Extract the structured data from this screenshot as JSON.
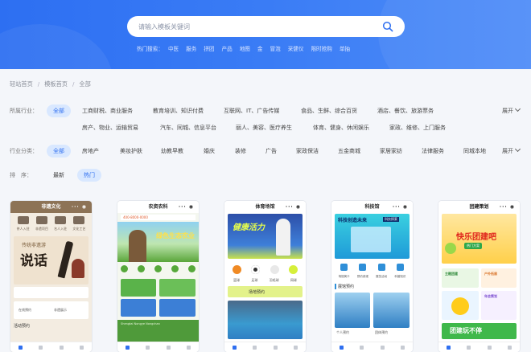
{
  "search": {
    "placeholder": "请输入模板关键词"
  },
  "hot": {
    "label": "热门搜索：",
    "items": [
      "中医",
      "服务",
      "拼团",
      "产品",
      "地图",
      "金",
      "冒泡",
      "采健仪",
      "限时抢购",
      "单抽"
    ]
  },
  "breadcrumb": [
    "轻站首页",
    "模板首页",
    "全部"
  ],
  "industry": {
    "label": "所属行业：",
    "row1": [
      "全部",
      "工商财税、商业服务",
      "教育培训、知识付费",
      "互联网、IT、广告传媒",
      "食品、生鲜、综合百货",
      "酒店、餐饮、旅游票务"
    ],
    "row2": [
      "房产、物业、运输贸易",
      "汽车、同城、信息平台",
      "丽人、美容、医疗养生",
      "体育、健身、休闲娱乐",
      "家政、维修、上门服务"
    ],
    "expand": "展开"
  },
  "category": {
    "label": "行业分类：",
    "items": [
      "全部",
      "房地产",
      "美妆护肤",
      "幼教早教",
      "婚庆",
      "装修",
      "广告",
      "家政保洁",
      "五金商城",
      "家居家纺",
      "法律服务",
      "同城本地"
    ],
    "expand": "展开"
  },
  "sort": {
    "label": "排　序：",
    "items": [
      "最新",
      "热门"
    ]
  },
  "colors": {
    "brand": "#2f6ff0",
    "active_bg": "#d9e8ff"
  },
  "templates": [
    {
      "title": "非遗文化",
      "icons": [
        "茶人入驻",
        "非遗项目",
        "名人入驻",
        "文化工艺"
      ],
      "headline": "说话",
      "line1": "传统非遗游",
      "bullets": [
        "在线预约",
        "非遗展示"
      ],
      "section": "活动预约",
      "nav": [
        "首页",
        "非遗活动",
        "非遗文化",
        "个人中心"
      ]
    },
    {
      "title": "农资农科",
      "phone": "400-8000-0000",
      "banner": "绿色生态农业",
      "icons": [
        "公司简介",
        "产品中心",
        "联系方式",
        "招商加盟",
        "合作伙伴"
      ],
      "section": "Shengtai Nongye Nongchan",
      "nav": [
        "首页",
        "产品中心",
        "联系我们",
        "个人中心"
      ]
    },
    {
      "title": "体育场馆",
      "banner": "健康活力",
      "icons": [
        "篮球",
        "足球",
        "羽毛球",
        "网球"
      ],
      "section": "场地预约",
      "nav": [
        "首页",
        "场地预约",
        "活动",
        "我的"
      ]
    },
    {
      "title": "科技馆",
      "banner": "科技创造未来",
      "tag": "科技探索",
      "icons": [
        "场馆简介",
        "预约参观",
        "展览活动",
        "科普知识"
      ],
      "section": "展馆预约",
      "cards": [
        "个人预约",
        "团体预约"
      ],
      "nav": [
        "首页",
        "展馆",
        "活动",
        "我的"
      ]
    },
    {
      "title": "团建策划",
      "banner": "快乐团建吧",
      "sub": "热门方案",
      "icons": [
        "主题团建",
        "户外拓展",
        "年会策划"
      ],
      "footer": "团建玩不停",
      "nav": [
        "首页",
        "团建",
        "案例",
        "我的"
      ]
    }
  ]
}
